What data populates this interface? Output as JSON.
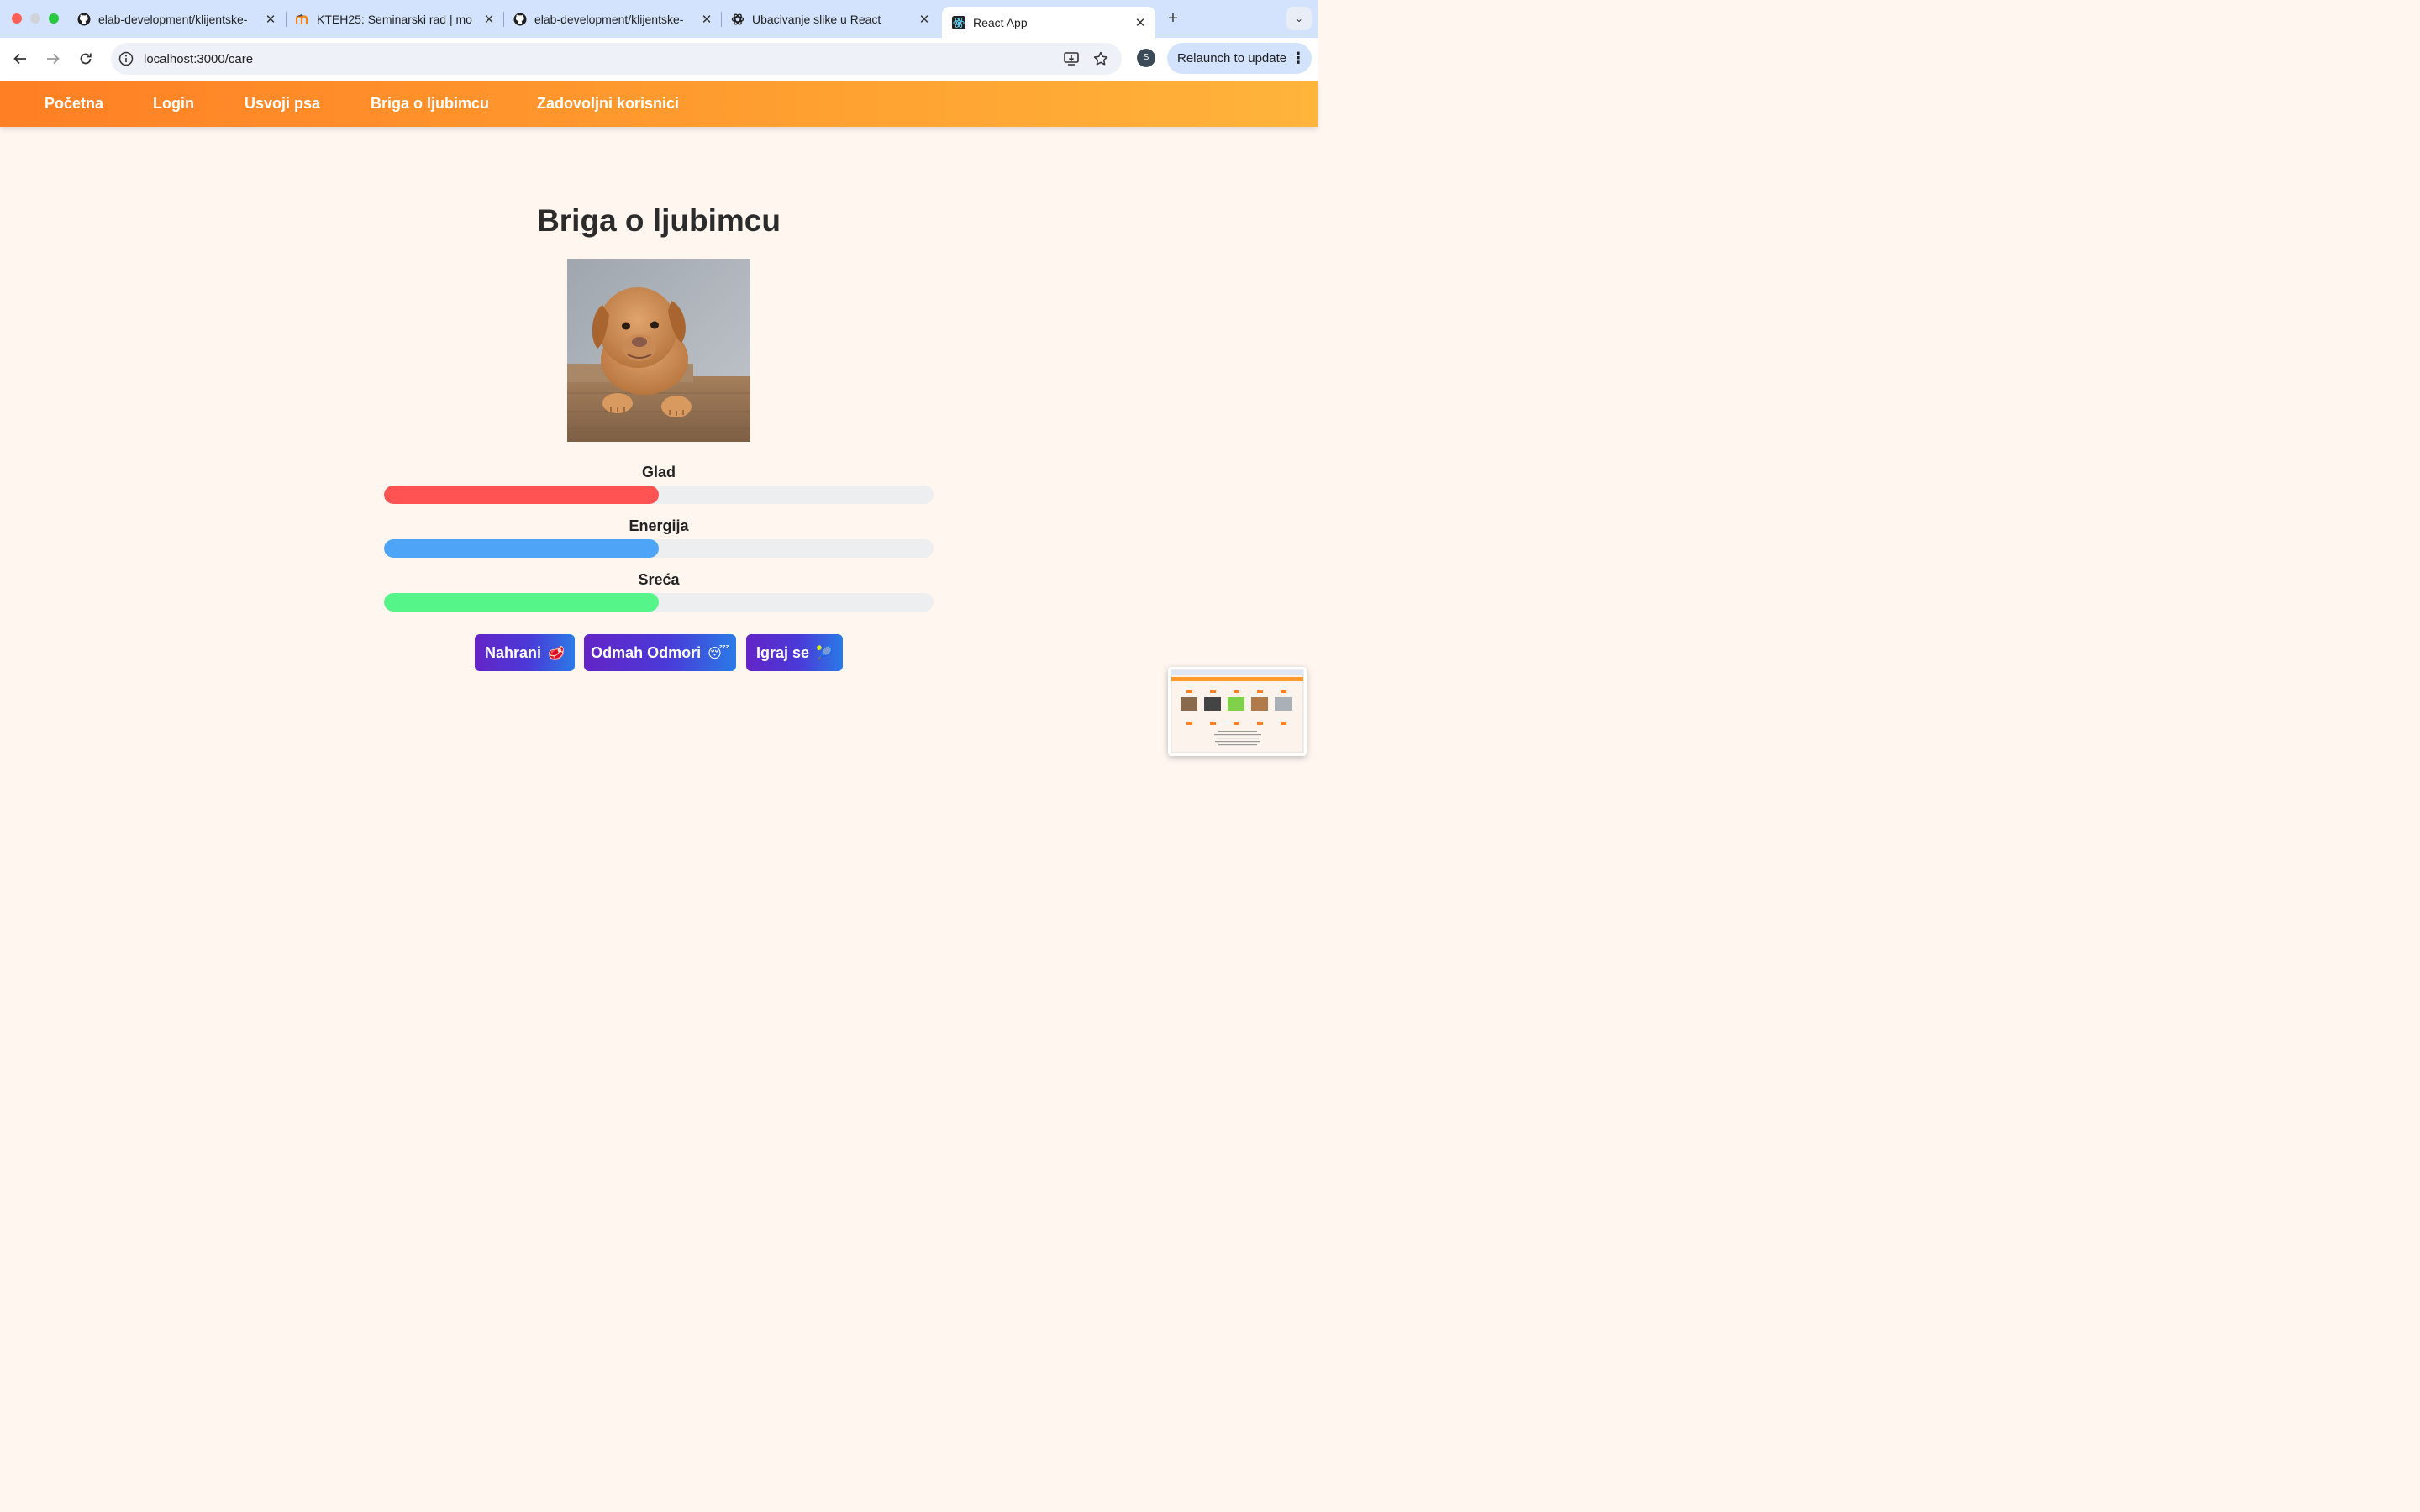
{
  "browser": {
    "tabs": [
      {
        "title": "elab-development/klijentske-",
        "icon": "github-icon"
      },
      {
        "title": "KTEH25: Seminarski rad | mo",
        "icon": "moodle-icon"
      },
      {
        "title": "elab-development/klijentske-",
        "icon": "github-icon"
      },
      {
        "title": "Ubacivanje slike u React",
        "icon": "openai-icon"
      },
      {
        "title": "React App",
        "icon": "react-icon",
        "active": true
      }
    ],
    "url": "localhost:3000/care",
    "avatar_initial": "S",
    "relaunch_label": "Relaunch to update"
  },
  "nav": {
    "items": [
      "Početna",
      "Login",
      "Usvoji psa",
      "Briga o ljubimcu",
      "Zadovoljni korisnici"
    ]
  },
  "page": {
    "title": "Briga o ljubimcu",
    "stats": [
      {
        "label": "Glad",
        "value": 0.5,
        "color": "#ff5252"
      },
      {
        "label": "Energija",
        "value": 0.5,
        "color": "#4ea4f7"
      },
      {
        "label": "Sreća",
        "value": 0.5,
        "color": "#55f58a"
      }
    ],
    "buttons": [
      {
        "label": "Nahrani",
        "emoji": "🥩"
      },
      {
        "label": "Odmah Odmori",
        "emoji": "😴"
      },
      {
        "label": "Igraj se",
        "emoji": "🎾"
      }
    ]
  },
  "colors": {
    "nav_gradient_start": "#ff7f24",
    "nav_gradient_end": "#ffb43a",
    "page_background": "#fff6f0",
    "button_gradient_start": "#6424c6",
    "button_gradient_end": "#2a7ae6"
  }
}
